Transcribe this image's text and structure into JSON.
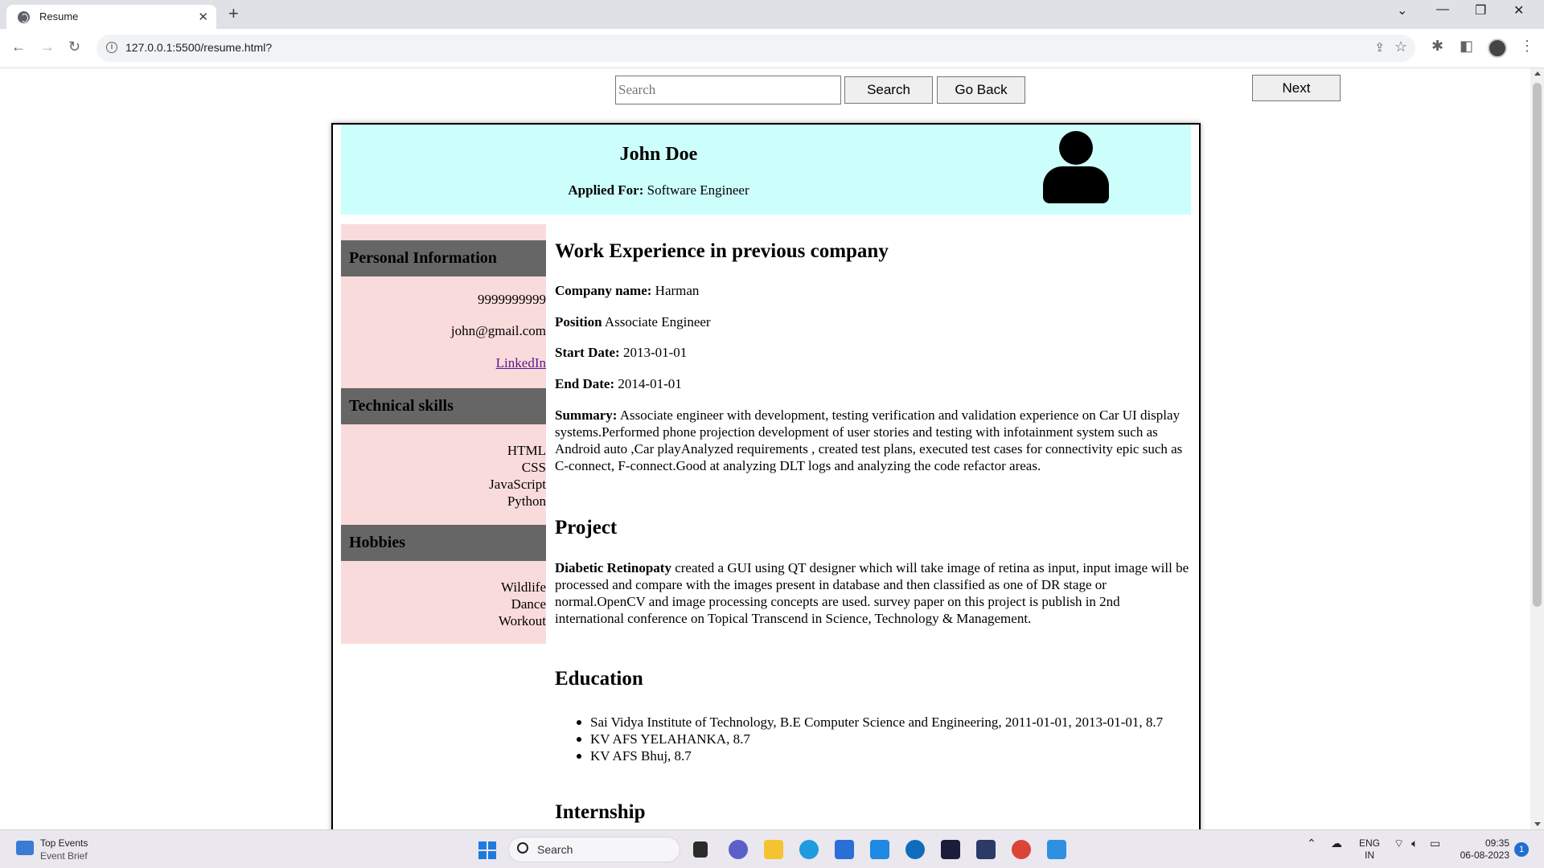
{
  "browser": {
    "tab_title": "Resume",
    "url": "127.0.0.1:5500/resume.html?"
  },
  "page": {
    "search_placeholder": "Search",
    "search_button": "Search",
    "back_button": "Go Back",
    "next_button": "Next"
  },
  "resume": {
    "name": "John Doe",
    "applied_label": "Applied For:",
    "applied_value": "Software Engineer",
    "personal_heading": "Personal Information",
    "phone": "9999999999",
    "email": "john@gmail.com",
    "linkedin": "LinkedIn",
    "skills_heading": "Technical skills",
    "skills": [
      "HTML",
      "CSS",
      "JavaScript",
      "Python"
    ],
    "hobbies_heading": "Hobbies",
    "hobbies": [
      "Wildlife",
      "Dance",
      "Workout"
    ],
    "work": {
      "heading": "Work Experience in previous company",
      "company_label": "Company name:",
      "company": "Harman",
      "position_label": "Position",
      "position": "Associate Engineer",
      "start_label": "Start Date:",
      "start": "2013-01-01",
      "end_label": "End Date:",
      "end": "2014-01-01",
      "summary_label": "Summary:",
      "summary": "Associate engineer with development, testing verification and validation experience on Car UI display systems.Performed phone projection development of user stories and testing with infotainment system such as Android auto ,Car playAnalyzed requirements , created test plans, executed test cases for connectivity epic such as C-connect, F-connect.Good at analyzing DLT logs and analyzing the code refactor areas."
    },
    "project": {
      "heading": "Project",
      "title": "Diabetic Retinopaty",
      "description": "created a GUI using QT designer which will take image of retina as input, input image will be processed and compare with the images present in database and then classified as one of DR stage or normal.OpenCV and image processing concepts are used. survey paper on this project is publish in 2nd international conference on Topical Transcend in Science, Technology & Management."
    },
    "education": {
      "heading": "Education",
      "items": [
        "Sai Vidya Institute of Technology, B.E Computer Science and Engineering, 2011-01-01, 2013-01-01, 8.7",
        "KV AFS YELAHANKA, 8.7",
        "KV AFS Bhuj, 8.7"
      ]
    },
    "internship": {
      "heading": "Internship"
    }
  },
  "taskbar": {
    "widget_title": "Top Events",
    "widget_subtitle": "Event Brief",
    "search_text": "Search",
    "lang_top": "ENG",
    "lang_bottom": "IN",
    "time": "09:35",
    "date": "06-08-2023",
    "notifications": "1"
  },
  "colors": {
    "header_band": "#ccfffc",
    "sidebar": "#fadbdc",
    "section_head": "#666666"
  }
}
